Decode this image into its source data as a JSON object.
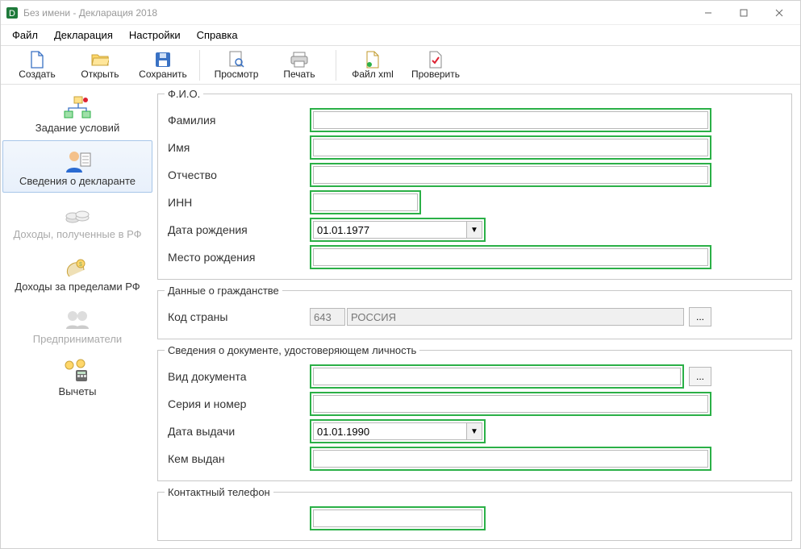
{
  "window": {
    "title": "Без имени - Декларация 2018"
  },
  "menubar": {
    "file": "Файл",
    "declaration": "Декларация",
    "settings": "Настройки",
    "help": "Справка"
  },
  "toolbar": {
    "create": "Создать",
    "open": "Открыть",
    "save": "Сохранить",
    "preview": "Просмотр",
    "print": "Печать",
    "filexml": "Файл xml",
    "check": "Проверить"
  },
  "sidebar": {
    "conditions": "Задание условий",
    "declarant": "Сведения о декларанте",
    "income_rf": "Доходы, полученные в РФ",
    "income_foreign": "Доходы за пределами РФ",
    "entrepreneurs": "Предприниматели",
    "deductions": "Вычеты"
  },
  "form": {
    "fio_group": "Ф.И.О.",
    "surname": "Фамилия",
    "name": "Имя",
    "patronymic": "Отчество",
    "inn": "ИНН",
    "dob": "Дата рождения",
    "dob_value": "01.01.1977",
    "birthplace": "Место рождения",
    "citizenship_group": "Данные о гражданстве",
    "country_code": "Код страны",
    "country_code_value": "643",
    "country_name_value": "РОССИЯ",
    "iddoc_group": "Сведения о документе, удостоверяющем личность",
    "doc_type": "Вид документа",
    "series_number": "Серия и номер",
    "issue_date": "Дата выдачи",
    "issue_date_value": "01.01.1990",
    "issued_by": "Кем выдан",
    "phone_group": "Контактный телефон",
    "ellipsis": "..."
  }
}
